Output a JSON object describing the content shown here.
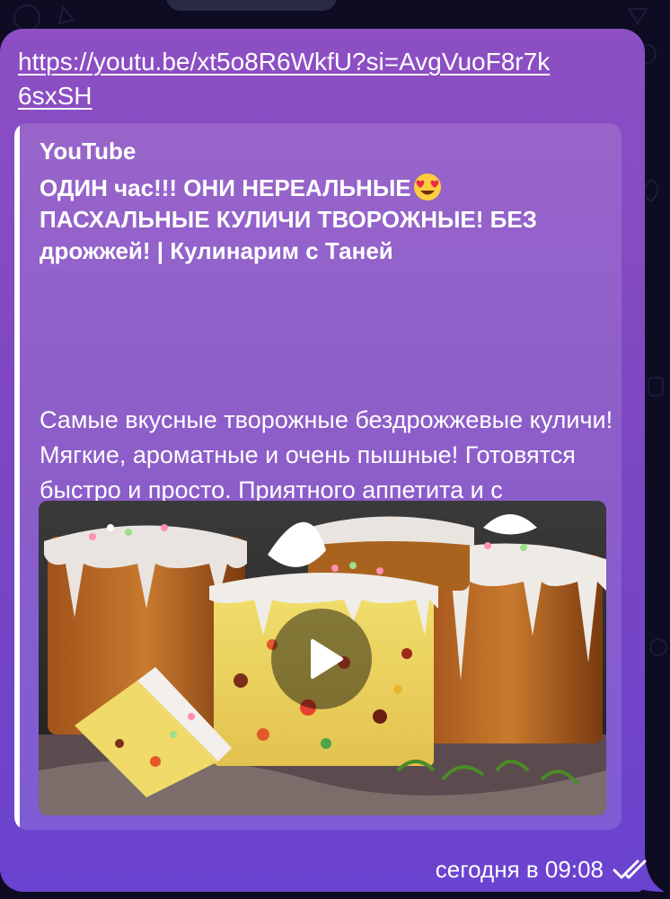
{
  "message": {
    "link_text": "https://youtu.be/xt5o8R6WkfU?si=AvgVuoF8r7k6sxSH",
    "time_label": "сегодня в 09:08",
    "read_status_icon": "double-check-icon"
  },
  "link_preview": {
    "site_name": "YouTube",
    "title": "ОДИН час!!! ОНИ НЕРЕАЛЬНЫЕ",
    "title_emoji": "😍",
    "title_rest": "ПАСХАЛЬНЫЕ КУЛИЧИ ТВОРОЖНЫЕ! БЕЗ дрожжей! | Кулинарим с Таней",
    "description": "Самые вкусные творожные бездрожжевые куличи! Мягкие, ароматные и очень пышные! Готовятся быстро и просто. Приятного аппетита и с наступающим праздником Светлой Пасхи! #выпечка #творожныекуличи #куличи…",
    "thumbnail": "easter-cakes-thumbnail",
    "play_icon": "play-icon"
  },
  "colors": {
    "bubble_top": "#8d4fc3",
    "bubble_bottom": "#6a43d0",
    "background": "#0d0c22"
  }
}
